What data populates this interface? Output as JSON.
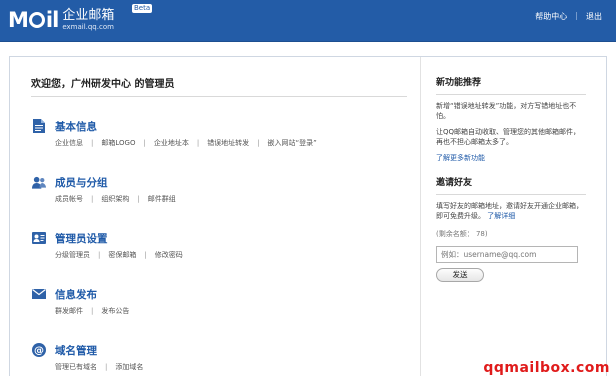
{
  "header": {
    "logo_mark": "Mail",
    "logo_cn": "企业邮箱",
    "logo_domain": "exmail.qq.com",
    "beta": "Beta",
    "links": {
      "help": "帮助中心",
      "sep": "|",
      "logout": "退出"
    },
    "bg_color": "#235ca7"
  },
  "main": {
    "welcome": "欢迎您，广州研发中心 的管理员",
    "sections": [
      {
        "title": "基本信息",
        "icon": "document-icon",
        "links": [
          "企业信息",
          "邮箱LOGO",
          "企业地址本",
          "错误地址转发",
          "嵌入网站“登录”"
        ]
      },
      {
        "title": "成员与分组",
        "icon": "users-icon",
        "links": [
          "成员帐号",
          "组织架构",
          "邮件群组"
        ]
      },
      {
        "title": "管理员设置",
        "icon": "id-card-icon",
        "links": [
          "分级管理员",
          "密保邮箱",
          "修改密码"
        ]
      },
      {
        "title": "信息发布",
        "icon": "envelope-icon",
        "links": [
          "群发邮件",
          "发布公告"
        ]
      },
      {
        "title": "域名管理",
        "icon": "at-sign-icon",
        "links": [
          "管理已有域名",
          "添加域名"
        ]
      }
    ]
  },
  "side": {
    "features": {
      "title": "新功能推荐",
      "p1": "新增“错误地址转发”功能，对方写错地址也不怕。",
      "p2": "让QQ邮箱自动收取、管理您的其他邮箱邮件，再也不担心邮箱太多了。",
      "more": "了解更多新功能"
    },
    "invite": {
      "title": "邀请好友",
      "desc": "填写好友的邮箱地址，邀请好友开通企业邮箱，即可免费升级。",
      "detail": "了解详细",
      "remain": "(剩余名额： 78)",
      "placeholder": "例如：username@qq.com",
      "send": "发送"
    }
  },
  "watermark": "qqmailbox.com"
}
